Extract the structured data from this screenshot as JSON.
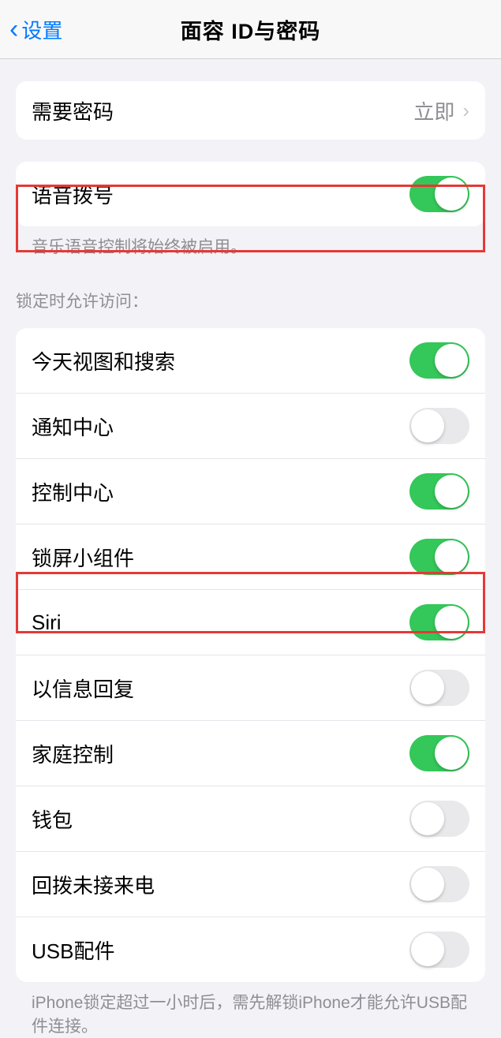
{
  "header": {
    "back_label": "设置",
    "title": "面容 ID与密码"
  },
  "passcode_group": {
    "require_passcode": {
      "label": "需要密码",
      "value": "立即"
    }
  },
  "voice_dial_group": {
    "voice_dial": {
      "label": "语音拨号",
      "on": true
    },
    "footer": "音乐语音控制将始终被启用。"
  },
  "lock_access": {
    "header": "锁定时允许访问：",
    "items": [
      {
        "label": "今天视图和搜索",
        "on": true
      },
      {
        "label": "通知中心",
        "on": false
      },
      {
        "label": "控制中心",
        "on": true
      },
      {
        "label": "锁屏小组件",
        "on": true
      },
      {
        "label": "Siri",
        "on": true
      },
      {
        "label": "以信息回复",
        "on": false
      },
      {
        "label": "家庭控制",
        "on": true
      },
      {
        "label": "钱包",
        "on": false
      },
      {
        "label": "回拨未接来电",
        "on": false
      },
      {
        "label": "USB配件",
        "on": false
      }
    ],
    "footer": "iPhone锁定超过一小时后，需先解锁iPhone才能允许USB配件连接。"
  }
}
